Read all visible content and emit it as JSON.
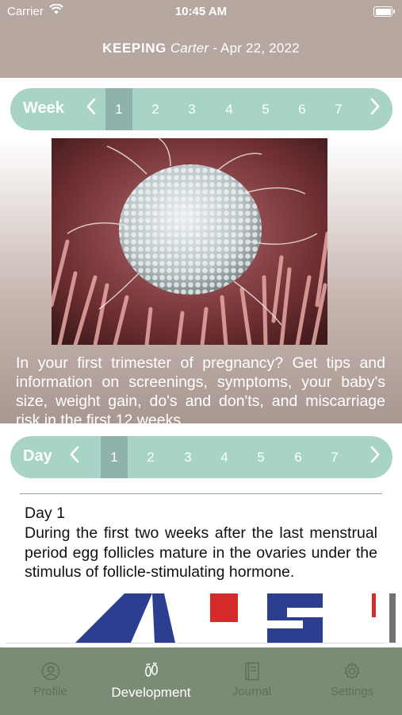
{
  "status_bar": {
    "carrier": "Carrier",
    "time": "10:45 AM"
  },
  "header": {
    "keyword": "KEEPING",
    "name": "Carter",
    "separator": " -  ",
    "date": "Apr 22, 2022"
  },
  "week_selector": {
    "label": "Week",
    "items": [
      "1",
      "2",
      "3",
      "4",
      "5",
      "6",
      "7"
    ],
    "selected": "1"
  },
  "week_content": {
    "text": "In your first trimester of pregnancy? Get tips and information on screenings, symptoms, your baby's size, weight gain, do's and don'ts, and miscarriage risk in the first 12 weeks."
  },
  "day_selector": {
    "label": "Day",
    "items": [
      "1",
      "2",
      "3",
      "4",
      "5",
      "6",
      "7"
    ],
    "selected": "1"
  },
  "day_content": {
    "title": "Day 1",
    "text": "During the first two weeks after the last menstrual period egg follicles mature in the ovaries under the stimulus of follicle-stimulating hormone."
  },
  "tabs": [
    {
      "label": "Profile",
      "icon": "person-icon",
      "active": false
    },
    {
      "label": "Development",
      "icon": "footprints-icon",
      "active": true
    },
    {
      "label": "Journal",
      "icon": "journal-icon",
      "active": false
    },
    {
      "label": "Settings",
      "icon": "gear-icon",
      "active": false
    }
  ],
  "colors": {
    "header": "#b6a7a1",
    "selector": "#a7d4c7",
    "selector_active": "#8fb3ab",
    "tabbar": "#7a8c75"
  }
}
